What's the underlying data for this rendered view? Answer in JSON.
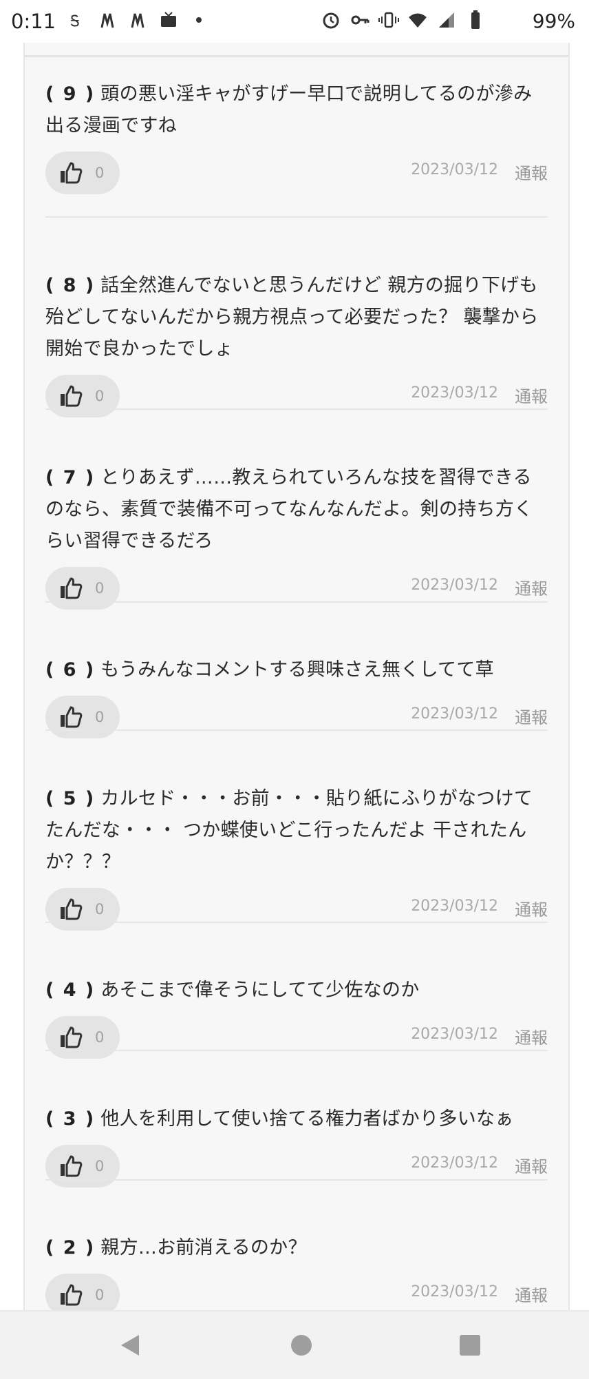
{
  "status_bar": {
    "time": "0:11",
    "battery": "99%"
  },
  "comments": [
    {
      "num": "( 9 )",
      "text": "頭の悪い淫キャがすげー早口で説明してるのが滲み出る漫画ですね",
      "likes": "0",
      "date": "2023/03/12",
      "report": "通報"
    },
    {
      "num": "( 8 )",
      "text": "話全然進んでないと思うんだけど 親方の掘り下げも殆どしてないんだから親方視点って必要だった？ 襲撃から開始で良かったでしょ",
      "likes": "0",
      "date": "2023/03/12",
      "report": "通報"
    },
    {
      "num": "( 7 )",
      "text": "とりあえず……教えられていろんな技を習得できるのなら、素質で装備不可ってなんなんだよ。剣の持ち方くらい習得できるだろ",
      "likes": "0",
      "date": "2023/03/12",
      "report": "通報"
    },
    {
      "num": "( 6 )",
      "text": "もうみんなコメントする興味さえ無くしてて草",
      "likes": "0",
      "date": "2023/03/12",
      "report": "通報"
    },
    {
      "num": "( 5 )",
      "text": "カルセド・・・お前・・・貼り紙にふりがなつけてたんだな・・・ つか蝶使いどこ行ったんだよ 干されたんか？？？",
      "likes": "0",
      "date": "2023/03/12",
      "report": "通報"
    },
    {
      "num": "( 4 )",
      "text": "あそこまで偉そうにしてて少佐なのか",
      "likes": "0",
      "date": "2023/03/12",
      "report": "通報"
    },
    {
      "num": "( 3 )",
      "text": "他人を利用して使い捨てる権力者ばかり多いなぁ",
      "likes": "0",
      "date": "2023/03/12",
      "report": "通報"
    },
    {
      "num": "( 2 )",
      "text": "親方…お前消えるのか？",
      "likes": "0",
      "date": "2023/03/12",
      "report": "通報"
    }
  ]
}
